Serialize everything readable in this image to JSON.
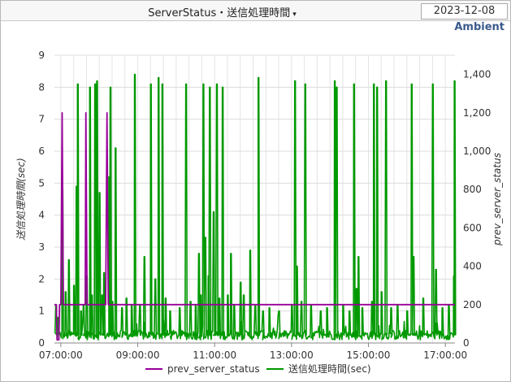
{
  "header": {
    "title": "ServerStatus・送信処理時間",
    "date": "2023-12-08",
    "brand": "Ambient"
  },
  "chart_data": {
    "type": "line",
    "title": "ServerStatus・送信処理時間",
    "xlabel": "",
    "ylabel_left": "送信処理時間(sec)",
    "ylabel_right": "prev_server_status",
    "x_ticks": [
      "07:00:00",
      "09:00:00",
      "11:00:00",
      "13:00:00",
      "15:00:00",
      "17:00:00"
    ],
    "x_range": [
      "06:50",
      "17:15"
    ],
    "y_left_ticks": [
      "0",
      "1",
      "2",
      "3",
      "4",
      "5",
      "6",
      "7",
      "8",
      "9"
    ],
    "y_left_range": [
      0,
      9
    ],
    "y_right_ticks": [
      "0",
      "200",
      "400",
      "600",
      "800",
      "1,000",
      "1,200",
      "1,400"
    ],
    "y_right_range": [
      0,
      1500
    ],
    "grid": true,
    "legend_position": "bottom",
    "series": [
      {
        "name": "prev_server_status",
        "color": "#990099",
        "axis": "left",
        "points": [
          [
            "06:50",
            1.2
          ],
          [
            "06:53",
            1.2
          ],
          [
            "06:54",
            0.1
          ],
          [
            "06:57",
            0.1
          ],
          [
            "06:58",
            1.2
          ],
          [
            "07:00",
            1.2
          ],
          [
            "07:02",
            7.2
          ],
          [
            "07:04",
            1.2
          ],
          [
            "07:38",
            1.2
          ],
          [
            "07:39",
            7.2
          ],
          [
            "07:41",
            1.2
          ],
          [
            "08:10",
            1.2
          ],
          [
            "08:12",
            7.2
          ],
          [
            "08:14",
            1.2
          ],
          [
            "17:15",
            1.2
          ]
        ]
      },
      {
        "name": "送信処理時間(sec)",
        "color": "#009900",
        "axis": "right",
        "baseline": 0.25,
        "spikes": [
          [
            "06:52",
            1.2
          ],
          [
            "06:55",
            0.8
          ],
          [
            "07:02",
            4.8
          ],
          [
            "07:07",
            1.6
          ],
          [
            "07:12",
            2.6
          ],
          [
            "07:20",
            1.8
          ],
          [
            "07:24",
            4.9
          ],
          [
            "07:26",
            8.1
          ],
          [
            "07:31",
            1.0
          ],
          [
            "07:35",
            1.2
          ],
          [
            "07:40",
            2.1
          ],
          [
            "07:45",
            8.0
          ],
          [
            "07:48",
            1.5
          ],
          [
            "07:53",
            8.1
          ],
          [
            "07:56",
            8.2
          ],
          [
            "08:00",
            4.7
          ],
          [
            "08:04",
            1.5
          ],
          [
            "08:07",
            2.2
          ],
          [
            "08:15",
            5.2
          ],
          [
            "08:17",
            8.0
          ],
          [
            "08:20",
            1.3
          ],
          [
            "08:25",
            6.1
          ],
          [
            "08:35",
            1.1
          ],
          [
            "08:42",
            1.4
          ],
          [
            "08:50",
            1.2
          ],
          [
            "08:55",
            8.4
          ],
          [
            "09:03",
            1.2
          ],
          [
            "09:10",
            2.7
          ],
          [
            "09:20",
            8.1
          ],
          [
            "09:27",
            2.0
          ],
          [
            "09:32",
            8.3
          ],
          [
            "09:38",
            8.1
          ],
          [
            "09:43",
            1.4
          ],
          [
            "09:50",
            1.0
          ],
          [
            "10:05",
            1.1
          ],
          [
            "10:15",
            8.1
          ],
          [
            "10:22",
            1.3
          ],
          [
            "10:30",
            1.2
          ],
          [
            "10:35",
            2.8
          ],
          [
            "10:38",
            1.5
          ],
          [
            "10:42",
            8.1
          ],
          [
            "10:45",
            3.3
          ],
          [
            "10:50",
            2.1
          ],
          [
            "10:52",
            8.0
          ],
          [
            "10:58",
            4.1
          ],
          [
            "11:03",
            8.1
          ],
          [
            "11:07",
            1.4
          ],
          [
            "11:12",
            8.0
          ],
          [
            "11:20",
            1.5
          ],
          [
            "11:25",
            2.8
          ],
          [
            "11:30",
            1.2
          ],
          [
            "11:40",
            1.9
          ],
          [
            "11:45",
            1.5
          ],
          [
            "11:55",
            2.9
          ],
          [
            "12:03",
            1.2
          ],
          [
            "12:08",
            8.3
          ],
          [
            "12:15",
            1.0
          ],
          [
            "12:25",
            1.1
          ],
          [
            "12:40",
            1.0
          ],
          [
            "13:00",
            1.2
          ],
          [
            "13:05",
            8.2
          ],
          [
            "13:08",
            2.4
          ],
          [
            "13:15",
            1.3
          ],
          [
            "13:21",
            8.1
          ],
          [
            "13:30",
            1.2
          ],
          [
            "13:45",
            1.0
          ],
          [
            "13:55",
            1.1
          ],
          [
            "14:07",
            8.2
          ],
          [
            "14:10",
            8.0
          ],
          [
            "14:20",
            1.2
          ],
          [
            "14:30",
            1.0
          ],
          [
            "14:37",
            8.1
          ],
          [
            "14:41",
            1.7
          ],
          [
            "14:44",
            2.7
          ],
          [
            "14:50",
            1.1
          ],
          [
            "15:05",
            1.3
          ],
          [
            "15:08",
            8.1
          ],
          [
            "15:13",
            8.0
          ],
          [
            "15:20",
            1.6
          ],
          [
            "15:27",
            8.2
          ],
          [
            "15:35",
            1.1
          ],
          [
            "15:45",
            1.2
          ],
          [
            "16:00",
            1.0
          ],
          [
            "16:07",
            8.1
          ],
          [
            "16:10",
            2.7
          ],
          [
            "16:25",
            1.4
          ],
          [
            "16:40",
            8.1
          ],
          [
            "16:45",
            2.3
          ],
          [
            "16:55",
            1.1
          ],
          [
            "17:05",
            1.2
          ],
          [
            "17:13",
            2.1
          ],
          [
            "17:14",
            8.2
          ]
        ]
      }
    ]
  }
}
